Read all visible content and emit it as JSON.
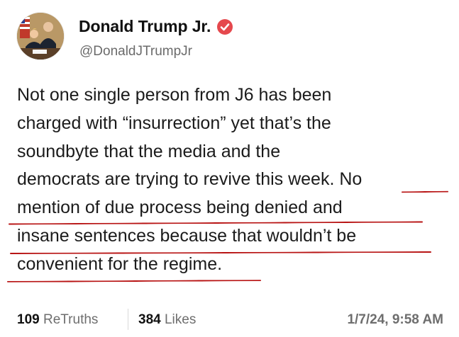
{
  "author": {
    "name": "Donald Trump Jr.",
    "handle": "@DonaldJTrumpJr",
    "verified_color": "#e5484d"
  },
  "post": {
    "lines": [
      "Not one single person from J6 has been",
      "charged with “insurrection” yet that’s the",
      "soundbyte that the media and the",
      "democrats are trying to revive this week. No",
      "mention of due process being denied and",
      "insane sentences because that wouldn’t be",
      "convenient for the regime."
    ]
  },
  "stats": {
    "retruths_count": "109",
    "retruths_label": "ReTruths",
    "likes_count": "384",
    "likes_label": "Likes",
    "timestamp": "1/7/24, 9:58 AM"
  },
  "annotation": {
    "underline_color": "#b81414"
  }
}
